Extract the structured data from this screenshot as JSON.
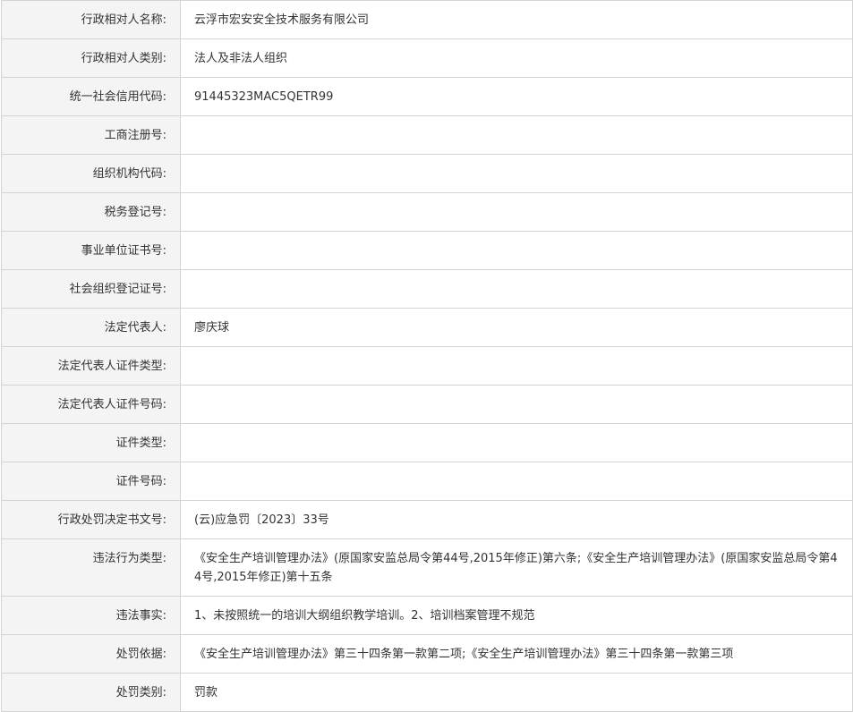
{
  "rows": [
    {
      "label": "行政相对人名称:",
      "value": "云浮市宏安安全技术服务有限公司"
    },
    {
      "label": "行政相对人类别:",
      "value": "法人及非法人组织"
    },
    {
      "label": "统一社会信用代码:",
      "value": "91445323MAC5QETR99"
    },
    {
      "label": "工商注册号:",
      "value": ""
    },
    {
      "label": "组织机构代码:",
      "value": ""
    },
    {
      "label": "税务登记号:",
      "value": ""
    },
    {
      "label": "事业单位证书号:",
      "value": ""
    },
    {
      "label": "社会组织登记证号:",
      "value": ""
    },
    {
      "label": "法定代表人:",
      "value": "廖庆球"
    },
    {
      "label": "法定代表人证件类型:",
      "value": ""
    },
    {
      "label": "法定代表人证件号码:",
      "value": ""
    },
    {
      "label": "证件类型:",
      "value": ""
    },
    {
      "label": "证件号码:",
      "value": ""
    },
    {
      "label": "行政处罚决定书文号:",
      "value": "(云)应急罚〔2023〕33号"
    },
    {
      "label": "违法行为类型:",
      "value": "《安全生产培训管理办法》(原国家安监总局令第44号,2015年修正)第六条;《安全生产培训管理办法》(原国家安监总局令第44号,2015年修正)第十五条"
    },
    {
      "label": "违法事实:",
      "value": "1、未按照统一的培训大纲组织教学培训。2、培训档案管理不规范"
    },
    {
      "label": "处罚依据:",
      "value": "《安全生产培训管理办法》第三十四条第一款第二项;《安全生产培训管理办法》第三十四条第一款第三项"
    },
    {
      "label": "处罚类别:",
      "value": "罚款"
    }
  ]
}
